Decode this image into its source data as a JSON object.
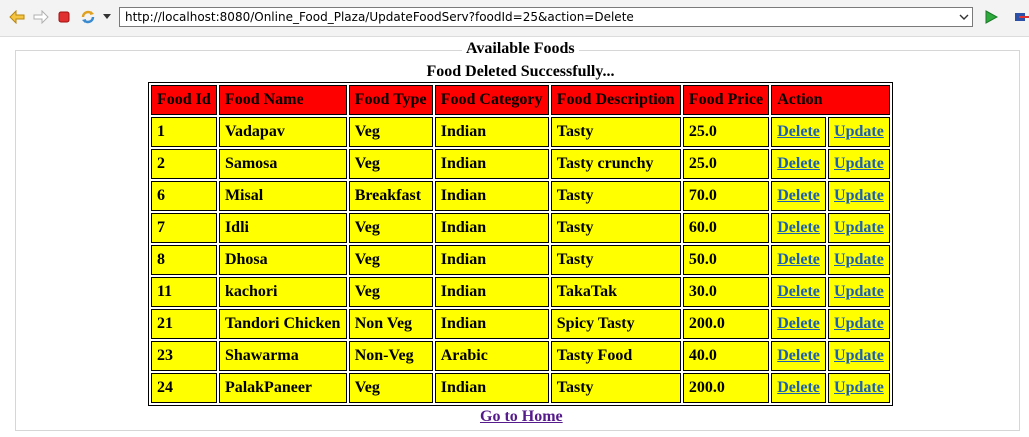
{
  "browser": {
    "url": "http://localhost:8080/Online_Food_Plaza/UpdateFoodServ?foodId=25&action=Delete"
  },
  "page": {
    "legend": "Available Foods",
    "status": "Food Deleted Successfully...",
    "home_link": "Go to Home"
  },
  "table": {
    "headers": [
      "Food Id",
      "Food Name",
      "Food Type",
      "Food Category",
      "Food Description",
      "Food Price",
      "Action"
    ],
    "action_delete": "Delete",
    "action_update": "Update",
    "rows": [
      [
        "1",
        "Vadapav",
        "Veg",
        "Indian",
        "Tasty",
        "25.0"
      ],
      [
        "2",
        "Samosa",
        "Veg",
        "Indian",
        "Tasty crunchy",
        "25.0"
      ],
      [
        "6",
        "Misal",
        "Breakfast",
        "Indian",
        "Tasty",
        "70.0"
      ],
      [
        "7",
        "Idli",
        "Veg",
        "Indian",
        "Tasty",
        "60.0"
      ],
      [
        "8",
        "Dhosa",
        "Veg",
        "Indian",
        "Tasty",
        "50.0"
      ],
      [
        "11",
        "kachori",
        "Veg",
        "Indian",
        "TakaTak",
        "30.0"
      ],
      [
        "21",
        "Tandori Chicken",
        "Non Veg",
        "Indian",
        "Spicy Tasty",
        "200.0"
      ],
      [
        "23",
        "Shawarma",
        "Non-Veg",
        "Arabic",
        "Tasty Food",
        "40.0"
      ],
      [
        "24",
        "PalakPaneer",
        "Veg",
        "Indian",
        "Tasty",
        "200.0"
      ]
    ]
  },
  "icons": [
    "back-arrow-icon",
    "forward-arrow-icon",
    "stop-icon",
    "refresh-icon",
    "dropdown-icon",
    "go-icon"
  ]
}
